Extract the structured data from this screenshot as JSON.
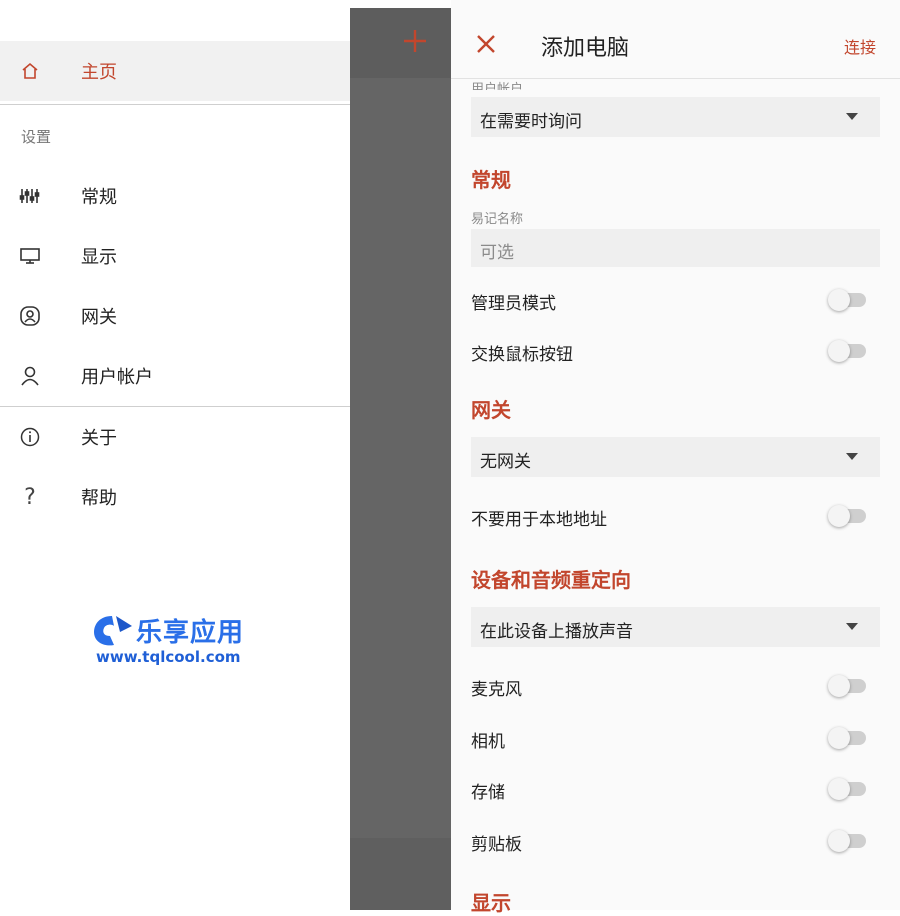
{
  "drawer": {
    "home_label": "主页",
    "settings_section": "设置",
    "items": [
      {
        "label": "常规"
      },
      {
        "label": "显示"
      },
      {
        "label": "网关"
      },
      {
        "label": "用户帐户"
      },
      {
        "label": "关于"
      },
      {
        "label": "帮助"
      }
    ],
    "watermark_text": "乐享应用",
    "watermark_url": "www.tqlcool.com"
  },
  "panel": {
    "title": "添加电脑",
    "connect_label": "连接",
    "user_account_caption": "用户帐户",
    "user_account_value": "在需要时询问",
    "general_header": "常规",
    "friendly_name_caption": "易记名称",
    "friendly_name_placeholder": "可选",
    "admin_mode_label": "管理员模式",
    "swap_mouse_label": "交换鼠标按钮",
    "gateway_header": "网关",
    "gateway_value": "无网关",
    "bypass_local_label": "不要用于本地地址",
    "redirect_header": "设备和音频重定向",
    "audio_value": "在此设备上播放声音",
    "microphone_label": "麦克风",
    "camera_label": "相机",
    "storage_label": "存储",
    "clipboard_label": "剪贴板",
    "display_header": "显示"
  },
  "colors": {
    "accent": "#c2462d",
    "scrim": "#656565",
    "panel_bg": "#fafafa"
  }
}
